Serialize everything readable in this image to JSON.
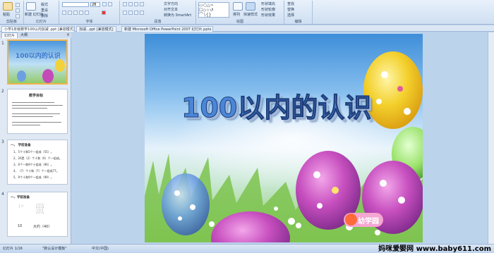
{
  "ribbon": {
    "clipboard": {
      "paste_label": "粘贴",
      "group_label": "剪贴板"
    },
    "slides": {
      "new_slide_label": "新建\n幻灯片",
      "layout_label": "版式",
      "reset_label": "重设",
      "delete_label": "删除",
      "group_label": "幻灯片"
    },
    "font": {
      "group_label": "字体",
      "size_value": "28"
    },
    "paragraph": {
      "group_label": "段落",
      "text_direction_label": "文字方向",
      "align_text_label": "对齐文本",
      "smartart_label": "转换为 SmartArt"
    },
    "drawing": {
      "group_label": "绘图",
      "arrange_label": "排列",
      "quick_styles_label": "快速样式",
      "shape_fill_label": "形状填充",
      "shape_outline_label": "形状轮廓",
      "shape_effects_label": "形状效果"
    },
    "editing": {
      "group_label": "编辑",
      "find_label": "查找",
      "replace_label": "替换",
      "select_label": "选择"
    }
  },
  "doc_tabs": [
    {
      "label": "小学1年级数学100以内加减 .ppt [兼容模式]",
      "active": true
    },
    {
      "label": "加减...ppt [兼容模式]",
      "active": false
    },
    {
      "label": "新建 Microsoft Office PowerPoint 2007 幻灯片.pptx",
      "active": false
    }
  ],
  "left_panel": {
    "tabs": [
      {
        "label": "幻灯片",
        "active": true
      },
      {
        "label": "大纲",
        "active": false
      }
    ],
    "close": "×",
    "thumbnails": [
      {
        "num": "1",
        "title": "100以内的认识"
      },
      {
        "num": "2",
        "title": "教学目标"
      },
      {
        "num": "3",
        "title": "一、 学前准备",
        "lines": [
          "1、5个十和5个一组成（55）。",
          "2、26是（2）个十和（6）个一组成。",
          "3、6个一和9个十组成（96）。",
          "4、（7）个十和（7）个一组成77。",
          "5、9个十和9个一组成（99）。"
        ]
      },
      {
        "num": "4",
        "title": "一、学前准备",
        "lines": [
          "10",
          "大约（40）"
        ]
      }
    ]
  },
  "slide": {
    "title": "100以内的认识",
    "logo_text": "幼学园",
    "colors": {
      "title_fill": "#4a86d8",
      "title_outline": "#1e3e7a"
    }
  },
  "status_bar": {
    "slide_info": "幻灯片 1/16",
    "theme": "\"默认设计模板\"",
    "language": "中文(中国)",
    "zoom": "64%"
  },
  "watermark": "妈咪爱婴网 www.baby611.com"
}
